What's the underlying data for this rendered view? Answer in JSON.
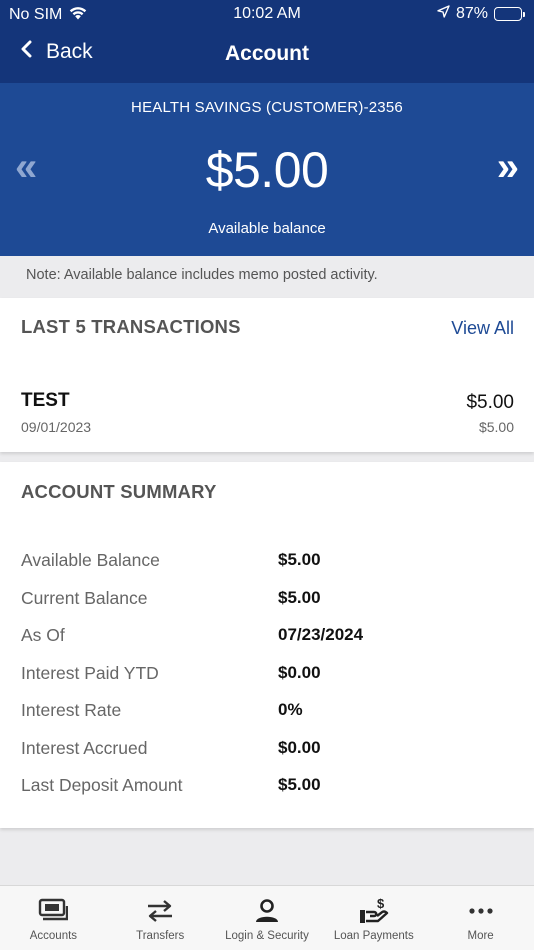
{
  "status_bar": {
    "carrier": "No SIM",
    "time": "10:02 AM",
    "battery": "87%",
    "battery_level": 0.87
  },
  "nav": {
    "back_label": "Back",
    "title": "Account"
  },
  "hero": {
    "account_name": "HEALTH SAVINGS (CUSTOMER)-2356",
    "balance": "$5.00",
    "balance_label": "Available balance",
    "prev_glyph": "«",
    "next_glyph": "»"
  },
  "note": "Note: Available balance includes memo posted activity.",
  "transactions": {
    "header": "LAST 5 TRANSACTIONS",
    "view_all": "View All",
    "items": [
      {
        "name": "TEST",
        "date": "09/01/2023",
        "amount": "$5.00",
        "running_balance": "$5.00"
      }
    ]
  },
  "summary": {
    "header": "ACCOUNT SUMMARY",
    "rows": [
      {
        "label": "Available Balance",
        "value": "$5.00"
      },
      {
        "label": "Current Balance",
        "value": "$5.00"
      },
      {
        "label": "As Of",
        "value": "07/23/2024"
      },
      {
        "label": "Interest Paid YTD",
        "value": "$0.00"
      },
      {
        "label": "Interest Rate",
        "value": "0%"
      },
      {
        "label": "Interest Accrued",
        "value": "$0.00"
      },
      {
        "label": "Last Deposit Amount",
        "value": "$5.00"
      }
    ]
  },
  "tabs": [
    {
      "label": "Accounts",
      "icon": "accounts-icon"
    },
    {
      "label": "Transfers",
      "icon": "transfers-icon"
    },
    {
      "label": "Login & Security",
      "icon": "person-icon"
    },
    {
      "label": "Loan Payments",
      "icon": "loan-payment-icon"
    },
    {
      "label": "More",
      "icon": "more-icon"
    }
  ],
  "colors": {
    "header_bg": "#14357a",
    "hero_bg": "#1e4a95",
    "link": "#1e4a95",
    "card_bg": "#ffffff",
    "page_bg": "#ececee"
  }
}
